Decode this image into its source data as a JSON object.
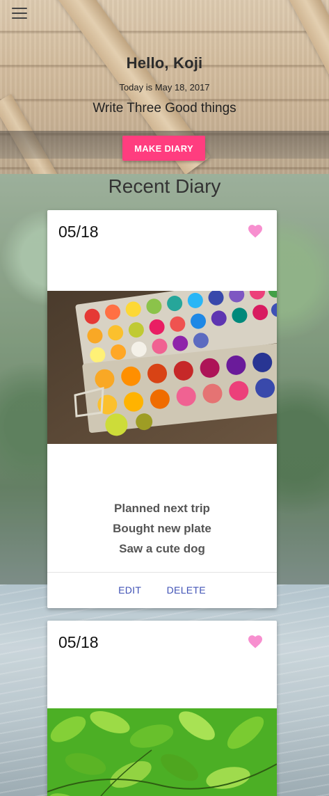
{
  "header": {
    "greeting": "Hello, Koji",
    "date_text": "Today is May 18, 2017",
    "prompt": "Write Three Good things",
    "make_button_label": "MAKE DIARY",
    "menu_icon": "hamburger-menu-icon"
  },
  "section_title": "Recent Diary",
  "colors": {
    "accent": "#ff3d7f",
    "heart": "#f78fcf",
    "action": "#3f51b5"
  },
  "diaries": [
    {
      "date": "05/18",
      "heart_icon": "heart-icon",
      "image": "watercolor-paint-palette",
      "lines": [
        "Planned next trip",
        "Bought new plate",
        "Saw a cute dog"
      ],
      "edit_label": "EDIT",
      "delete_label": "DELETE"
    },
    {
      "date": "05/18",
      "heart_icon": "heart-icon",
      "image": "green-leaves"
    }
  ]
}
